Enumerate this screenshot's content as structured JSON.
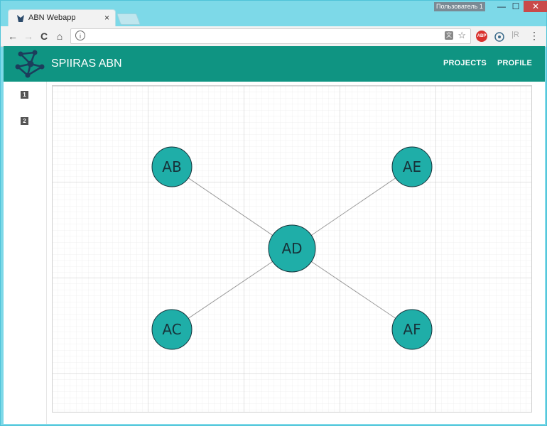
{
  "browser": {
    "tab_title": "ABN Webapp",
    "tab_close": "×",
    "user_badge": "Пользователь 1",
    "window_controls": {
      "minimize": "—",
      "maximize": "☐",
      "close": "✕"
    },
    "nav_icons": {
      "back": "←",
      "forward": "→",
      "reload": "C",
      "home": "⌂"
    },
    "address": {
      "info_icon": "i",
      "value": ""
    },
    "extensions": {
      "abp": "ABP",
      "r": "|R"
    },
    "menu": "⋮"
  },
  "app": {
    "brand": "SPIIRAS ABN",
    "nav": [
      {
        "label": "PROJECTS"
      },
      {
        "label": "PROFILE"
      }
    ],
    "sidebar": [
      {
        "label": "1"
      },
      {
        "label": "2"
      }
    ]
  },
  "graph": {
    "node_color": "#1faea8",
    "edge_color": "#9a9a9a",
    "nodes": [
      {
        "id": "AB",
        "label": "AB"
      },
      {
        "id": "AE",
        "label": "AE"
      },
      {
        "id": "AD",
        "label": "AD"
      },
      {
        "id": "AC",
        "label": "AC"
      },
      {
        "id": "AF",
        "label": "AF"
      }
    ],
    "edges": [
      {
        "from": "AB",
        "to": "AD"
      },
      {
        "from": "AE",
        "to": "AD"
      },
      {
        "from": "AC",
        "to": "AD"
      },
      {
        "from": "AF",
        "to": "AD"
      }
    ]
  }
}
